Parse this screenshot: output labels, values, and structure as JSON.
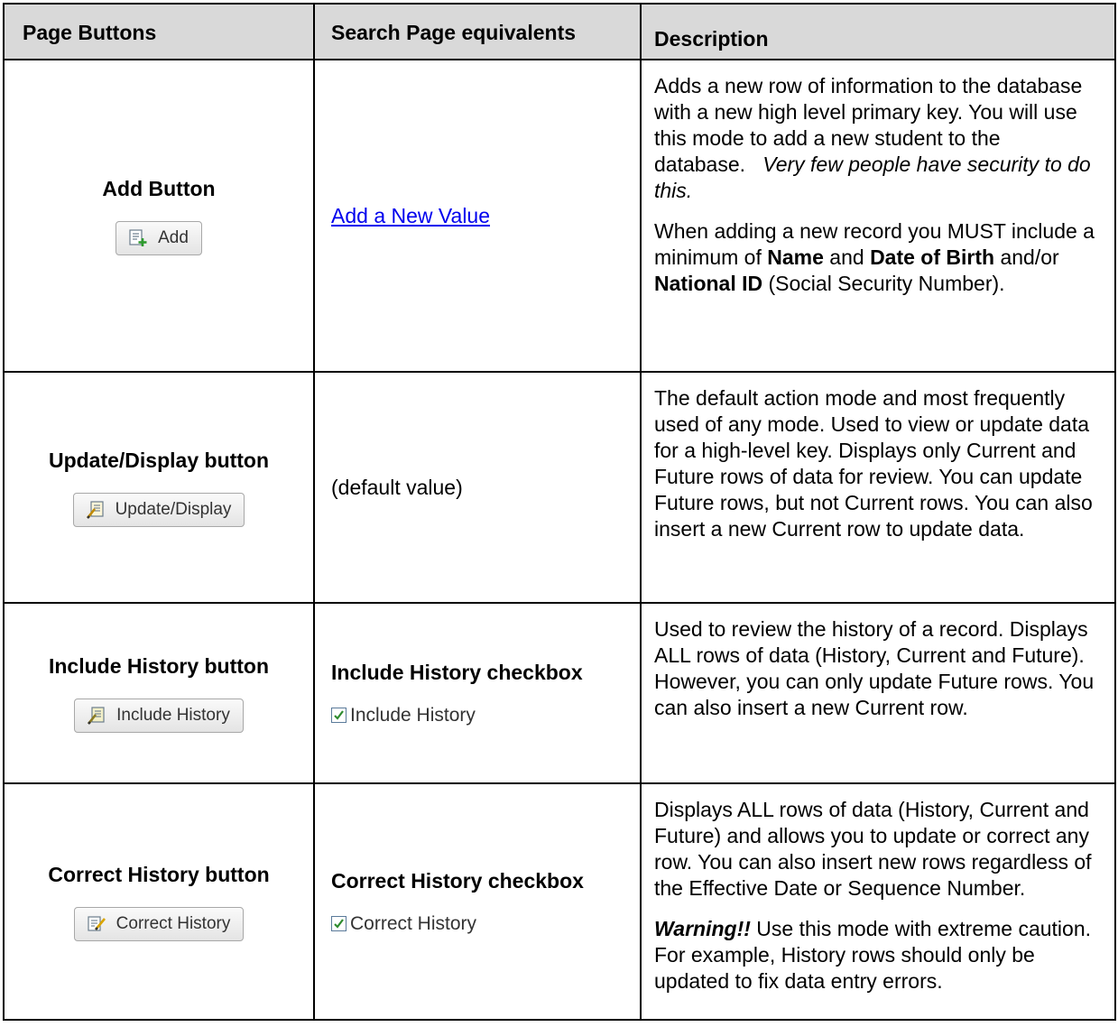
{
  "headers": {
    "col1": "Page Buttons",
    "col2": "Search Page equivalents",
    "col3": "Description"
  },
  "rows": [
    {
      "button_title": "Add Button",
      "button_label": "Add",
      "button_icon": "add-icon",
      "search_link": "Add a New Value",
      "desc_p1": "Adds a new row of information to the database with a new high level primary key. You will use this mode to add a new student to the database.",
      "desc_p1_italic": "Very few people have security to do this.",
      "desc_p2_a": "When adding a new record you MUST include a minimum of",
      "desc_p2_b1": "Name",
      "desc_p2_and": "and",
      "desc_p2_b2": "Date of Birth",
      "desc_p2_andor": "and/or",
      "desc_p2_b3": "National ID",
      "desc_p2_end": "(Social Security Number)."
    },
    {
      "button_title": "Update/Display button",
      "button_label": "Update/Display",
      "button_icon": "update-display-icon",
      "search_text": "(default value)",
      "desc_p1": "The default action mode and most frequently used of any mode. Used to view or update data for a high-level key. Displays only Current and Future rows of data for review. You can update Future rows, but not Current rows. You can also insert a new Current row to update data."
    },
    {
      "button_title": "Include History button",
      "button_label": "Include History",
      "button_icon": "include-history-icon",
      "search_title": "Include History checkbox",
      "checkbox_label": "Include History",
      "desc_p1": "Used to review the history of a record. Displays ALL rows of data (History, Current and Future). However, you can only update Future rows. You can also insert a new Current row."
    },
    {
      "button_title": "Correct History button",
      "button_label": "Correct History",
      "button_icon": "correct-history-icon",
      "search_title": "Correct History checkbox",
      "checkbox_label": "Correct History",
      "desc_p1": "Displays ALL rows of data (History, Current and Future) and allows you to update or correct any row. You can also insert new rows regardless of the Effective Date or Sequence Number.",
      "desc_p2_warning": "Warning!!",
      "desc_p2_text": "Use this mode with extreme caution. For example, History rows should only be updated to fix data entry errors."
    }
  ],
  "colors": {
    "header_bg": "#d9d9d9",
    "link": "#0000ee",
    "check": "#2e8b2e"
  }
}
